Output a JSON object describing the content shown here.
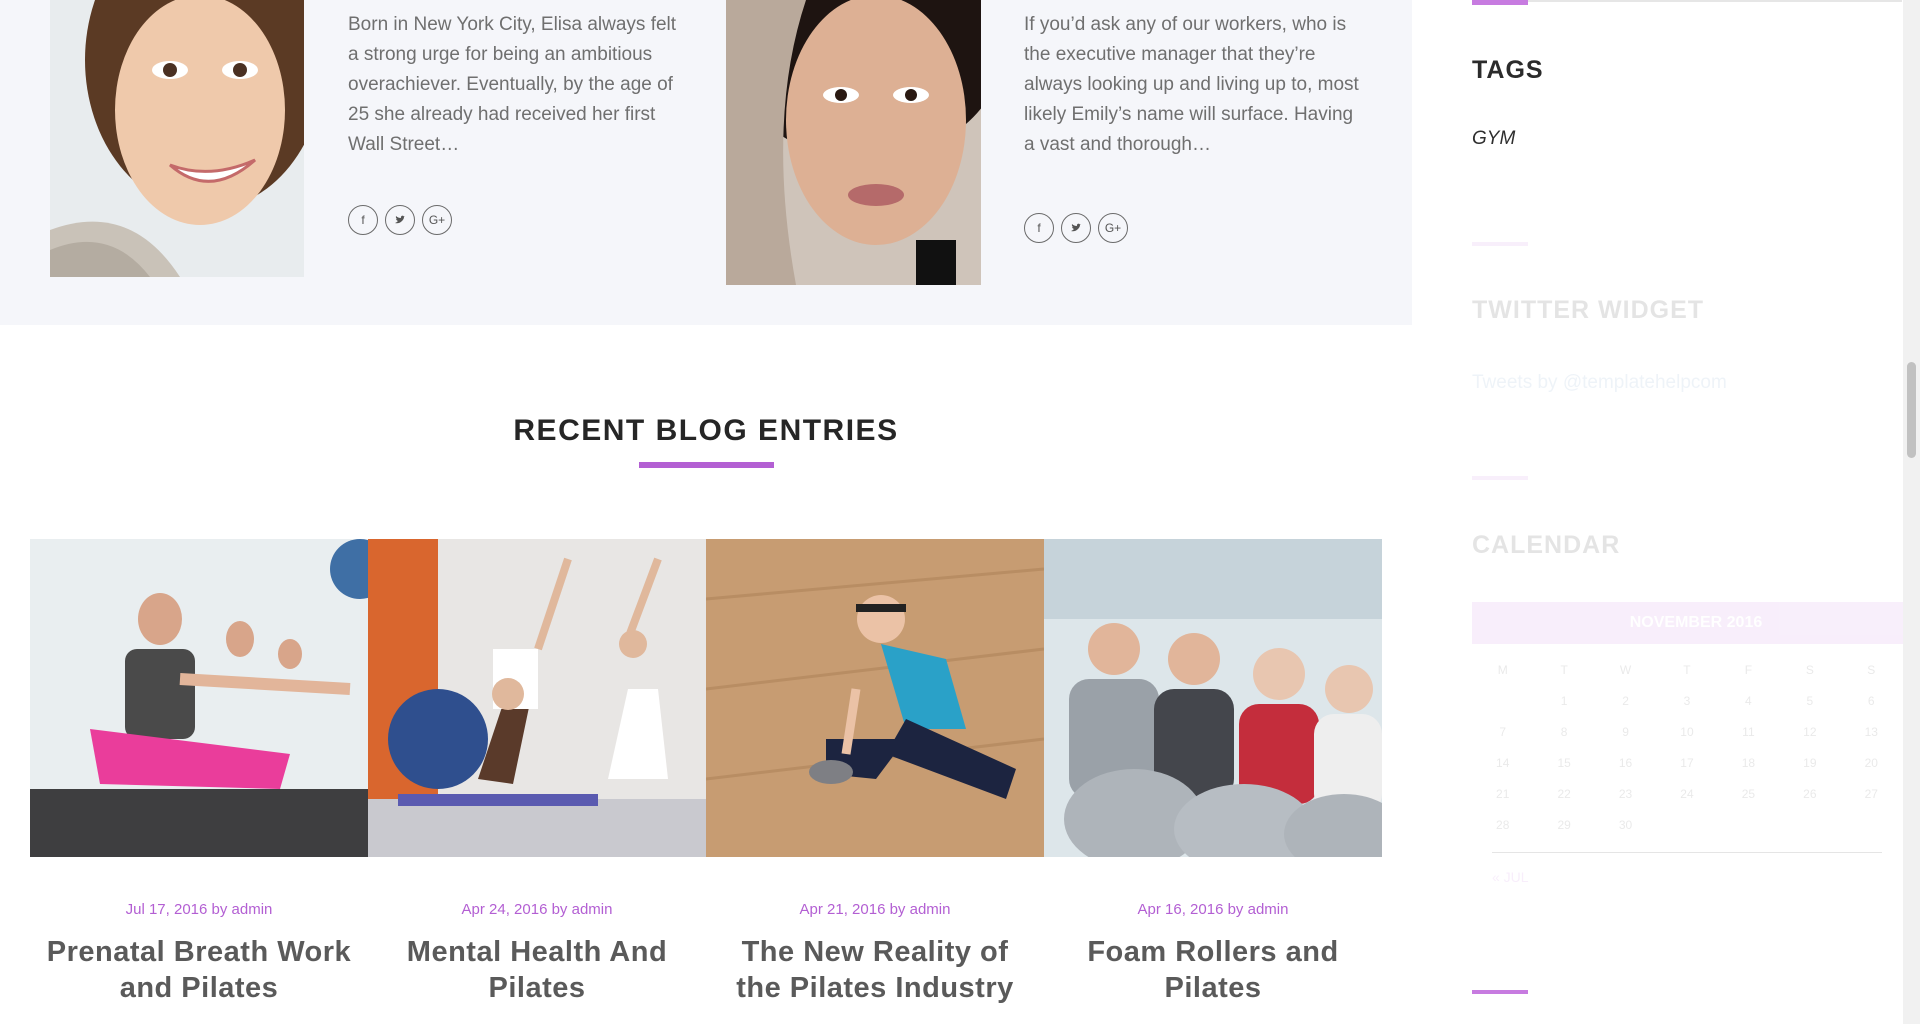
{
  "team": [
    {
      "bio": "Born in New York City, Elisa always felt a strong urge for being an ambitious overachiever. Eventually, by the age of 25 she already had received her first Wall Street…",
      "socials": [
        "f",
        "t",
        "G+"
      ]
    },
    {
      "bio": "If you’d ask any of our workers, who is the executive manager that they’re always looking up and living up to, most likely Emily’s name will surface. Having a vast and thorough…",
      "socials": [
        "f",
        "t",
        "G+"
      ]
    }
  ],
  "sidebar": {
    "tags_title": "TAGS",
    "tags": [
      "GYM"
    ],
    "twitter_title": "TWITTER WIDGET",
    "twitter_link": "Tweets by @templatehelpcom",
    "calendar_title": "CALENDAR",
    "calendar": {
      "caption": "NOVEMBER 2016",
      "weekdays": [
        "M",
        "T",
        "W",
        "T",
        "F",
        "S",
        "S"
      ],
      "weeks": [
        [
          "",
          "1",
          "2",
          "3",
          "4",
          "5",
          "6"
        ],
        [
          "7",
          "8",
          "9",
          "10",
          "11",
          "12",
          "13"
        ],
        [
          "14",
          "15",
          "16",
          "17",
          "18",
          "19",
          "20"
        ],
        [
          "21",
          "22",
          "23",
          "24",
          "25",
          "26",
          "27"
        ],
        [
          "28",
          "29",
          "30",
          "",
          "",
          "",
          ""
        ]
      ],
      "prev_link": "« JUL"
    }
  },
  "blog": {
    "title": "RECENT BLOG ENTRIES",
    "posts": [
      {
        "date": "Jul 17, 2016",
        "by": "by",
        "author": "admin",
        "title": "Prenatal Breath Work and Pilates"
      },
      {
        "date": "Apr 24, 2016",
        "by": "by",
        "author": "admin",
        "title": "Mental Health And Pilates"
      },
      {
        "date": "Apr 21, 2016",
        "by": "by",
        "author": "admin",
        "title": "The New Reality of the Pilates Industry"
      },
      {
        "date": "Apr 16, 2016",
        "by": "by",
        "author": "admin",
        "title": "Foam Rollers and Pilates"
      }
    ]
  },
  "colors": {
    "accent": "#c77be0",
    "meta": "#b35fd3",
    "band": "#f5f6fa"
  }
}
